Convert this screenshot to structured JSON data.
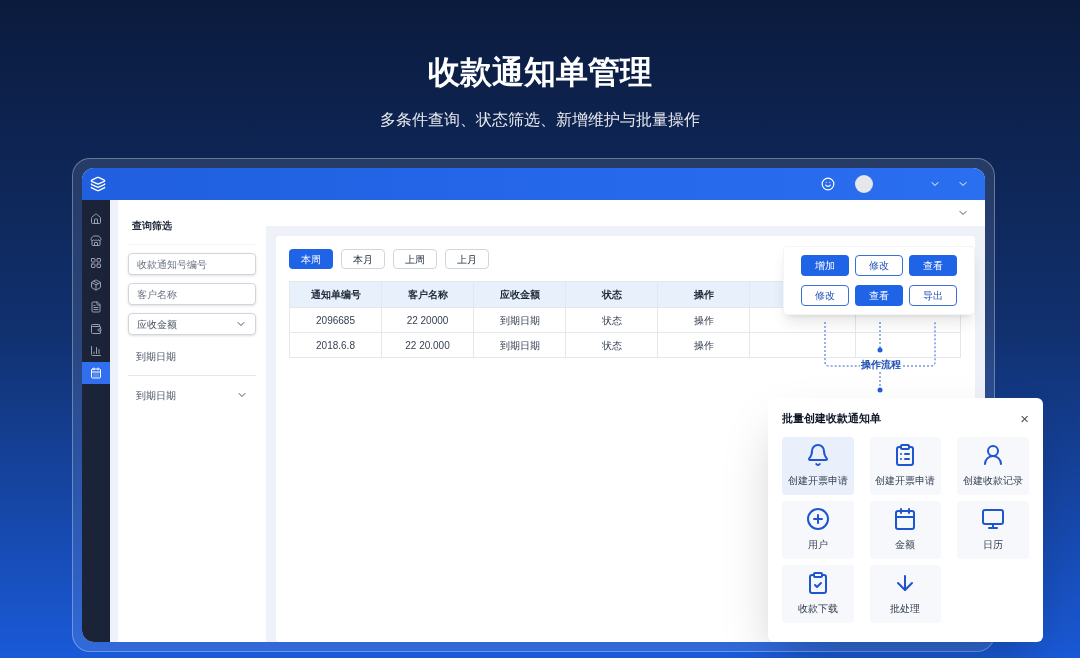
{
  "hero": {
    "title": "收款通知单管理",
    "subtitle": "多条件查询、状态筛选、新增维护与批量操作"
  },
  "sidebar": {
    "items": [
      {
        "selected": false
      },
      {
        "selected": false
      },
      {
        "selected": false
      },
      {
        "selected": false
      },
      {
        "selected": false
      },
      {
        "selected": false
      },
      {
        "selected": false
      },
      {
        "selected": true
      }
    ]
  },
  "filter_panel": {
    "title": "查询筛选",
    "fields": [
      {
        "kind": "input",
        "placeholder": "收款通知号编号"
      },
      {
        "kind": "input",
        "placeholder": "客户名称"
      },
      {
        "kind": "select",
        "value": "应收金额"
      },
      {
        "kind": "plain",
        "value": "到期日期"
      },
      {
        "kind": "dropdown",
        "value": "到期日期"
      }
    ]
  },
  "period_tabs": [
    {
      "label": "本周",
      "selected": true
    },
    {
      "label": "本月",
      "selected": false
    },
    {
      "label": "上周",
      "selected": false
    },
    {
      "label": "上月",
      "selected": false
    }
  ],
  "table": {
    "columns": [
      "通知单编号",
      "客户名称",
      "应收金额",
      "状态",
      "操作"
    ],
    "rows": [
      [
        "2096685",
        "22 20000",
        "到期日期",
        "状态",
        "操作"
      ],
      [
        "2018.6.8",
        "22 20.000",
        "到期日期",
        "状态",
        "操作"
      ]
    ]
  },
  "action_card": {
    "buttons": [
      {
        "label": "增加",
        "selected": true
      },
      {
        "label": "修改",
        "selected": false
      },
      {
        "label": "查看",
        "selected": true
      },
      {
        "label": "修改",
        "selected": false
      },
      {
        "label": "查看",
        "selected": true
      },
      {
        "label": "导出",
        "selected": false
      }
    ],
    "flow_label": "操作流程"
  },
  "batch_dialog": {
    "title": "批量创建收款通知单",
    "close": "×",
    "items": [
      {
        "label": "创建开票申请",
        "selected": true
      },
      {
        "label": "创建开票申请",
        "selected": false
      },
      {
        "label": "创建收款记录",
        "selected": false
      },
      {
        "label": "用户",
        "selected": false
      },
      {
        "label": "金额",
        "selected": false
      },
      {
        "label": "日历",
        "selected": false
      },
      {
        "label": "收款下载",
        "selected": false
      },
      {
        "label": "批处理",
        "selected": false
      }
    ]
  }
}
